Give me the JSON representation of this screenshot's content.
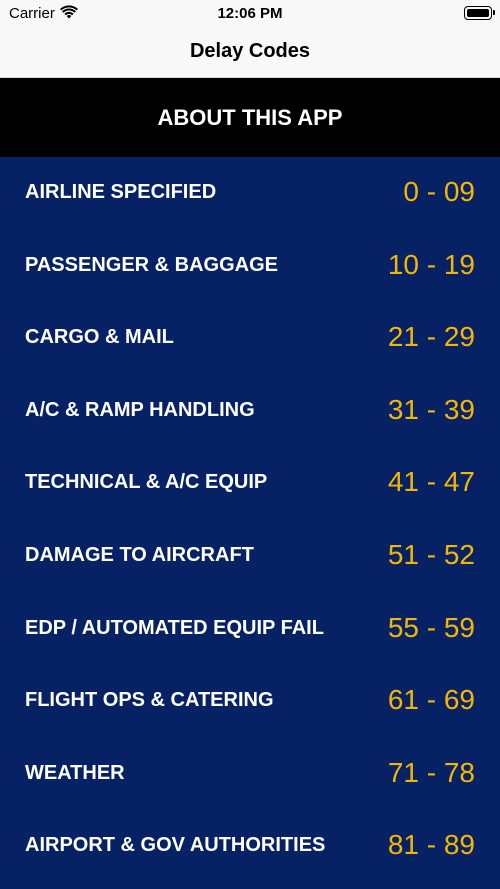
{
  "status_bar": {
    "carrier": "Carrier",
    "time": "12:06 PM"
  },
  "nav": {
    "title": "Delay Codes"
  },
  "about": {
    "label": "ABOUT THIS APP"
  },
  "colors": {
    "list_background": "#062164",
    "range_text": "#f2b705",
    "banner_background": "#000000"
  },
  "items": [
    {
      "label": "AIRLINE SPECIFIED",
      "range": "0 - 09"
    },
    {
      "label": "PASSENGER & BAGGAGE",
      "range": "10 - 19"
    },
    {
      "label": "CARGO & MAIL",
      "range": "21 - 29"
    },
    {
      "label": "A/C & RAMP HANDLING",
      "range": "31 - 39"
    },
    {
      "label": "TECHNICAL & A/C EQUIP",
      "range": "41 - 47"
    },
    {
      "label": "DAMAGE TO AIRCRAFT",
      "range": "51 - 52"
    },
    {
      "label": "EDP / AUTOMATED EQUIP FAIL",
      "range": "55 - 59"
    },
    {
      "label": "FLIGHT OPS & CATERING",
      "range": "61 - 69"
    },
    {
      "label": "WEATHER",
      "range": "71 - 78"
    },
    {
      "label": "AIRPORT & GOV AUTHORITIES",
      "range": "81 - 89"
    }
  ]
}
